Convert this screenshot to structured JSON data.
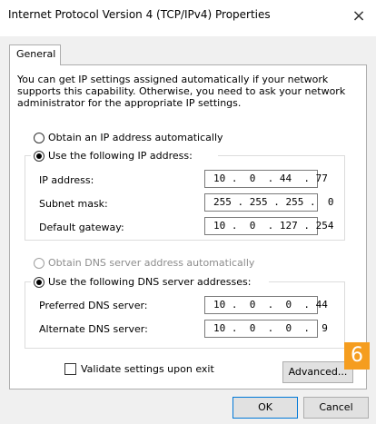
{
  "window": {
    "title": "Internet Protocol Version 4 (TCP/IPv4) Properties",
    "close_label": "×"
  },
  "tabs": [
    "General"
  ],
  "intro": "You can get IP settings assigned automatically if your network supports this capability. Otherwise, you need to ask your network administrator for the appropriate IP settings.",
  "ip_section": {
    "auto_label": "Obtain an IP address automatically",
    "manual_label": "Use the following IP address:",
    "selected": "manual",
    "fields": [
      {
        "label": "IP address:",
        "value": "10 .  0  . 44  . 77"
      },
      {
        "label": "Subnet mask:",
        "value": "255 . 255 . 255 .  0"
      },
      {
        "label": "Default gateway:",
        "value": "10 .  0  . 127 . 254"
      }
    ]
  },
  "dns_section": {
    "auto_label": "Obtain DNS server address automatically",
    "manual_label": "Use the following DNS server addresses:",
    "selected": "manual",
    "fields": [
      {
        "label": "Preferred DNS server:",
        "value": "10 .  0  .  0  . 44"
      },
      {
        "label": "Alternate DNS server:",
        "value": "10 .  0  .  0  .  9"
      }
    ]
  },
  "validate_label": "Validate settings upon exit",
  "buttons": {
    "advanced": "Advanced...",
    "ok": "OK",
    "cancel": "Cancel"
  },
  "badge": "6",
  "colors": {
    "accent": "#0078d7",
    "badge": "#f59d1f",
    "dialog_bg": "#f0f0f0"
  }
}
